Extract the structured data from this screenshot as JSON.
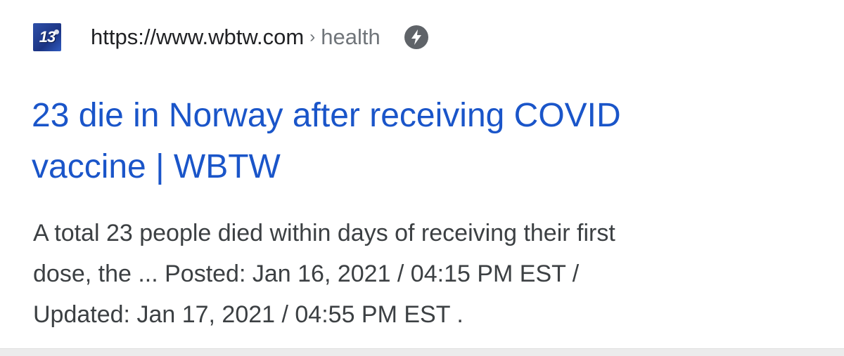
{
  "result": {
    "favicon_text": "13",
    "url": "https://www.wbtw.com",
    "breadcrumb_separator": "›",
    "breadcrumb": "health",
    "amp_icon": "lightning-bolt-icon",
    "title_lines": [
      "23 die in Norway after receiving COVID",
      "vaccine | WBTW"
    ],
    "snippet_lines": [
      "A total 23 people died within days of receiving their first",
      "dose, the ... Posted: Jan 16, 2021 / 04:15 PM EST /",
      "Updated: Jan 17, 2021 / 04:55 PM EST ."
    ]
  },
  "colors": {
    "title_link": "#1a55c9",
    "url_text": "#202124",
    "breadcrumb_text": "#70757a",
    "snippet_text": "#3c4043",
    "amp_badge": "#5f6368",
    "favicon_blue": "#2d4fa8"
  }
}
